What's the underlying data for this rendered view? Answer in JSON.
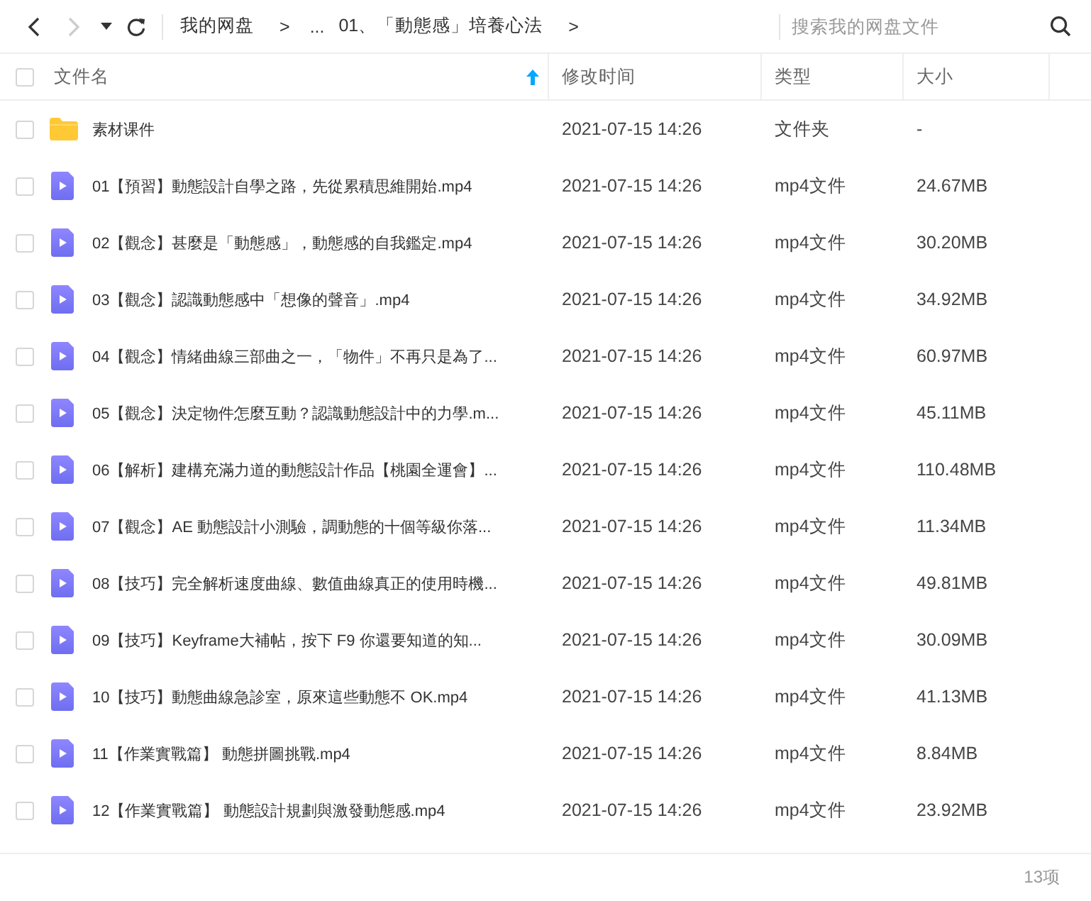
{
  "toolbar": {
    "back_disabled": false,
    "forward_disabled": true,
    "breadcrumbs": [
      {
        "kind": "crumb",
        "label": "我的网盘"
      },
      {
        "kind": "separator",
        "label": ">"
      },
      {
        "kind": "crumb",
        "label": "..."
      },
      {
        "kind": "crumb",
        "label": "01、「動態感」培養心法"
      },
      {
        "kind": "separator",
        "label": ">"
      }
    ],
    "search": {
      "placeholder": "搜索我的网盘文件"
    }
  },
  "table": {
    "select_all_checked": false,
    "columns": [
      {
        "label": "文件名",
        "sorted": true
      },
      {
        "label": "修改时间",
        "sorted": false
      },
      {
        "label": "类型",
        "sorted": false
      },
      {
        "label": "大小",
        "sorted": false
      }
    ],
    "rows": [
      {
        "kind": "folder",
        "name": "素材课件",
        "modified": "2021-07-15 14:26",
        "type": "文件夹",
        "size": "-",
        "checked": false
      },
      {
        "kind": "video",
        "name": "01【預習】動態設計自學之路，先從累積思維開始.mp4",
        "modified": "2021-07-15 14:26",
        "type": "mp4文件",
        "size": "24.67MB",
        "checked": false
      },
      {
        "kind": "video",
        "name": "02【觀念】甚麼是「動態感」，動態感的自我鑑定.mp4",
        "modified": "2021-07-15 14:26",
        "type": "mp4文件",
        "size": "30.20MB",
        "checked": false
      },
      {
        "kind": "video",
        "name": "03【觀念】認識動態感中「想像的聲音」.mp4",
        "modified": "2021-07-15 14:26",
        "type": "mp4文件",
        "size": "34.92MB",
        "checked": false
      },
      {
        "kind": "video",
        "name": "04【觀念】情緒曲線三部曲之一，「物件」不再只是為了...",
        "modified": "2021-07-15 14:26",
        "type": "mp4文件",
        "size": "60.97MB",
        "checked": false
      },
      {
        "kind": "video",
        "name": "05【觀念】決定物件怎麼互動？認識動態設計中的力學.m...",
        "modified": "2021-07-15 14:26",
        "type": "mp4文件",
        "size": "45.11MB",
        "checked": false
      },
      {
        "kind": "video",
        "name": "06【解析】建構充滿力道的動態設計作品【桃園全運會】...",
        "modified": "2021-07-15 14:26",
        "type": "mp4文件",
        "size": "110.48MB",
        "checked": false
      },
      {
        "kind": "video",
        "name": "07【觀念】AE 動態設計小測驗，調動態的十個等級你落...",
        "modified": "2021-07-15 14:26",
        "type": "mp4文件",
        "size": "11.34MB",
        "checked": false
      },
      {
        "kind": "video",
        "name": "08【技巧】完全解析速度曲線、數值曲線真正的使用時機...",
        "modified": "2021-07-15 14:26",
        "type": "mp4文件",
        "size": "49.81MB",
        "checked": false
      },
      {
        "kind": "video",
        "name": "09【技巧】Keyframe大補帖，按下 F9 你還要知道的知...",
        "modified": "2021-07-15 14:26",
        "type": "mp4文件",
        "size": "30.09MB",
        "checked": false
      },
      {
        "kind": "video",
        "name": "10【技巧】動態曲線急診室，原來這些動態不 OK.mp4",
        "modified": "2021-07-15 14:26",
        "type": "mp4文件",
        "size": "41.13MB",
        "checked": false
      },
      {
        "kind": "video",
        "name": "11【作業實戰篇】 動態拼圖挑戰.mp4",
        "modified": "2021-07-15 14:26",
        "type": "mp4文件",
        "size": "8.84MB",
        "checked": false
      },
      {
        "kind": "video",
        "name": "12【作業實戰篇】 動態設計規劃與激發動態感.mp4",
        "modified": "2021-07-15 14:26",
        "type": "mp4文件",
        "size": "23.92MB",
        "checked": false
      }
    ]
  },
  "footer": {
    "count": "13项"
  }
}
